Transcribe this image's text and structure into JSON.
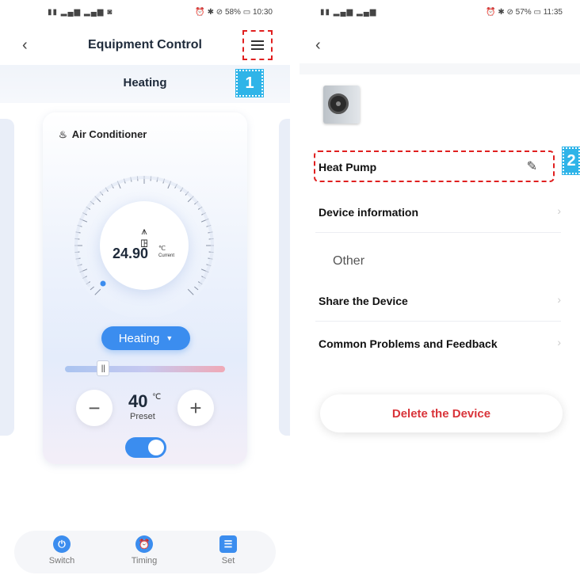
{
  "colors": {
    "accent": "#3b8def",
    "danger": "#d9343a",
    "annotation": "#e02020",
    "badge": "#2fb4e8"
  },
  "left_screen": {
    "status_time": "10:30",
    "status_battery": "58%",
    "header": {
      "title": "Equipment Control",
      "back_icon": "chevron-left-icon",
      "menu_icon": "hamburger-menu-icon"
    },
    "mode_title": "Heating",
    "annotation_badge": "1",
    "card": {
      "title": "Air Conditioner",
      "current_temp": "24.90",
      "current_unit": "℃",
      "current_label": "Current",
      "mode_button": "Heating",
      "slider_level": 0.2,
      "preset_value": "40",
      "preset_unit": "℃",
      "preset_label": "Preset",
      "power_toggle_on": true
    },
    "bottom_nav": [
      {
        "label": "Switch",
        "icon": "power-icon"
      },
      {
        "label": "Timing",
        "icon": "alarm-clock-icon"
      },
      {
        "label": "Set",
        "icon": "settings-sliders-icon"
      }
    ]
  },
  "right_screen": {
    "status_time": "11:35",
    "status_battery": "57%",
    "device_name": "Heat Pump",
    "annotation_badge": "2",
    "rows": [
      {
        "label": "Device information"
      }
    ],
    "section_other": "Other",
    "other_rows": [
      {
        "label": "Share the Device"
      },
      {
        "label": "Common Problems and Feedback"
      }
    ],
    "delete_button": "Delete the Device"
  }
}
